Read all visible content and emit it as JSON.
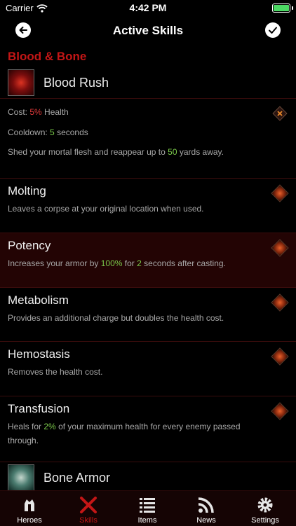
{
  "status": {
    "carrier": "Carrier",
    "time": "4:42 PM"
  },
  "nav": {
    "title": "Active Skills"
  },
  "section": {
    "title": "Blood & Bone"
  },
  "skills": [
    {
      "name": "Blood Rush",
      "details": {
        "cost_label": "Cost:",
        "cost_value": "5%",
        "cost_unit": "Health",
        "cooldown_label": "Cooldown:",
        "cooldown_value": "5",
        "cooldown_unit": "seconds",
        "desc_pre": "Shed your mortal flesh and reappear up to",
        "desc_value": "50",
        "desc_post": "yards away."
      },
      "runes": [
        {
          "name": "Molting",
          "desc": "Leaves a corpse at your original location when used.",
          "icon": "rune-molting-icon"
        },
        {
          "name": "Potency",
          "desc_pre": "Increases your armor by",
          "desc_v1": "100%",
          "desc_mid": "for",
          "desc_v2": "2",
          "desc_post": "seconds after casting.",
          "selected": true,
          "icon": "rune-potency-icon"
        },
        {
          "name": "Metabolism",
          "desc": "Provides an additional charge but doubles the health cost.",
          "icon": "rune-metabolism-icon"
        },
        {
          "name": "Hemostasis",
          "desc": "Removes the health cost.",
          "icon": "rune-hemostasis-icon"
        },
        {
          "name": "Transfusion",
          "desc_pre": "Heals for",
          "desc_v1": "2%",
          "desc_post": "of your maximum health for every enemy passed through.",
          "icon": "rune-transfusion-icon"
        }
      ]
    },
    {
      "name": "Bone Armor"
    }
  ],
  "tabs": [
    {
      "label": "Heroes",
      "icon": "heroes-icon"
    },
    {
      "label": "Skills",
      "icon": "skills-icon",
      "active": true
    },
    {
      "label": "Items",
      "icon": "items-icon"
    },
    {
      "label": "News",
      "icon": "news-icon"
    },
    {
      "label": "Settings",
      "icon": "settings-icon"
    }
  ],
  "colors": {
    "accent_red": "#c41616",
    "highlight_red": "#e23b3b",
    "value_green": "#7ac84a",
    "selected_row": "#230404"
  }
}
